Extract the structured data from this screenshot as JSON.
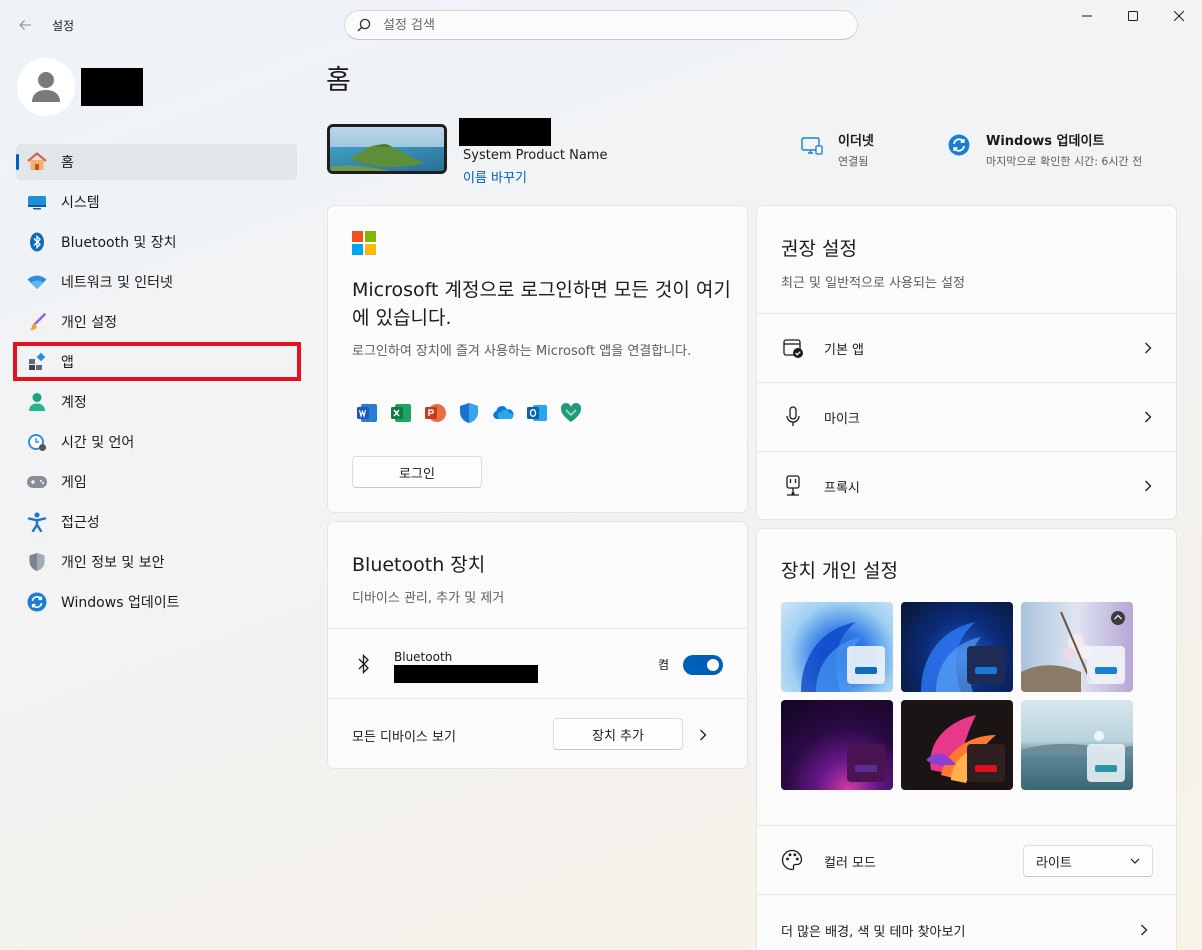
{
  "window": {
    "app_title": "설정",
    "search_placeholder": "설정 검색"
  },
  "sidebar": {
    "items": [
      {
        "label": "홈",
        "icon": "home-icon",
        "active": true
      },
      {
        "label": "시스템",
        "icon": "system-icon"
      },
      {
        "label": "Bluetooth 및 장치",
        "icon": "bluetooth-icon"
      },
      {
        "label": "네트워크 및 인터넷",
        "icon": "wifi-icon"
      },
      {
        "label": "개인 설정",
        "icon": "brush-icon"
      },
      {
        "label": "앱",
        "icon": "apps-icon"
      },
      {
        "label": "계정",
        "icon": "account-icon"
      },
      {
        "label": "시간 및 언어",
        "icon": "time-language-icon"
      },
      {
        "label": "게임",
        "icon": "gamepad-icon"
      },
      {
        "label": "접근성",
        "icon": "accessibility-icon"
      },
      {
        "label": "개인 정보 및 보안",
        "icon": "shield-icon"
      },
      {
        "label": "Windows 업데이트",
        "icon": "update-icon"
      }
    ]
  },
  "main": {
    "title": "홈",
    "device": {
      "product_name": "System Product Name",
      "rename_label": "이름 바꾸기"
    },
    "status": [
      {
        "title": "이더넷",
        "subtitle": "연결됨",
        "icon": "ethernet-icon"
      },
      {
        "title": "Windows 업데이트",
        "subtitle": "마지막으로 확인한 시간: 6시간 전",
        "icon": "update-icon"
      }
    ],
    "ms_card": {
      "heading": "Microsoft 계정으로 로그인하면 모든 것이 여기에 있습니다.",
      "description": "로그인하여 장치에 즐겨 사용하는 Microsoft 앱을 연결합니다.",
      "apps": [
        "word-icon",
        "excel-icon",
        "powerpoint-icon",
        "defender-icon",
        "onedrive-icon",
        "outlook-icon",
        "family-icon"
      ],
      "login_label": "로그인"
    },
    "bluetooth_card": {
      "title": "Bluetooth 장치",
      "subtitle": "디바이스 관리, 추가 및 제거",
      "device_label": "Bluetooth",
      "toggle_label": "켬",
      "toggle_on": true,
      "all_devices_label": "모든 디바이스 보기",
      "add_device_label": "장치 추가"
    },
    "recommended_card": {
      "title": "권장 설정",
      "subtitle": "최근 및 일반적으로 사용되는 설정",
      "items": [
        {
          "label": "기본 앱",
          "icon": "default-apps-icon"
        },
        {
          "label": "마이크",
          "icon": "microphone-icon"
        },
        {
          "label": "프록시",
          "icon": "proxy-icon"
        }
      ]
    },
    "personalize_card": {
      "title": "장치 개인 설정",
      "color_mode_label": "컬러 모드",
      "color_mode_value": "라이트",
      "more_label": "더 많은 배경, 색 및 테마 찾아보기",
      "accent_colors": [
        "#0f6cbd",
        "#1a78d6",
        "#1a7fd4",
        "#5a2d91",
        "#e0101c",
        "#2a94a8"
      ]
    }
  }
}
